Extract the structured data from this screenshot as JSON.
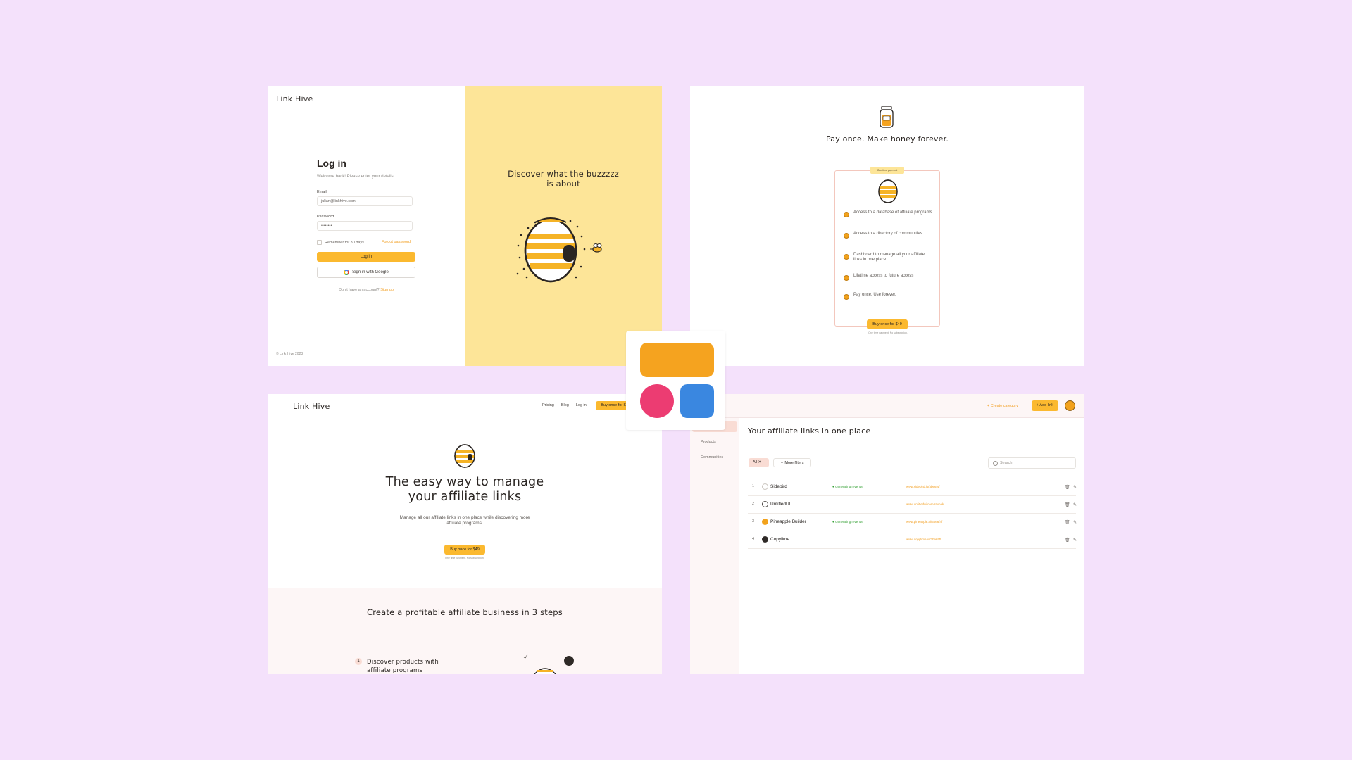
{
  "login": {
    "logo": "Link Hive",
    "title": "Log in",
    "subtitle": "Welcome back! Please enter your details.",
    "email_label": "Email",
    "email_value": "julian@linkhive.com",
    "password_label": "Password",
    "password_value": "••••••••",
    "remember": "Remember for 30 days",
    "forgot": "Forgot password",
    "login_button": "Log in",
    "google_button": "Sign in with Google",
    "no_account": "Don't have an account?",
    "signup": "Sign up",
    "copyright": "© Link Hive 2023",
    "tagline_1": "Discover what the buzzzzz",
    "tagline_2": "is about"
  },
  "pricing": {
    "headline": "Pay once. Make honey forever.",
    "badge": "One time payment",
    "features": [
      "Access to a database of affiliate programs",
      "Access to a directory of communities",
      "Dashboard to manage all your affiliate links in one place",
      "Lifetime access to future access",
      "Pay once. Use forever."
    ],
    "buy_button": "Buy once for $49",
    "note": "One time payment. No subscription."
  },
  "landing": {
    "logo": "Link Hive",
    "nav": [
      "Pricing",
      "Blog",
      "Log in"
    ],
    "nav_cta": "Buy once for $",
    "headline_1": "The easy way to manage",
    "headline_2": "your affiliate links",
    "description": "Manage all our affiliate links in one place while discovering more affiliate programs.",
    "buy_button": "Buy once for $49",
    "note": "One time payment. No subscription.",
    "steps_title": "Create a profitable affiliate business in 3 steps",
    "step_number": "1",
    "step_text": "Discover products with affiliate programs"
  },
  "dashboard": {
    "header_fragment": "e",
    "create_category": "+ Create category",
    "add_link": "+ Add link",
    "sidebar": [
      "Links",
      "Products",
      "Communities"
    ],
    "title": "Your affiliate links in one place",
    "filter_all": "All",
    "more_filters": "More filters",
    "search_placeholder": "Search",
    "rows": [
      {
        "idx": "1",
        "name": "Sidebird",
        "status": "Generating revenue",
        "url": "www.sidebird.io/3be6f4f",
        "icon_color": "#ffffff"
      },
      {
        "idx": "2",
        "name": "UntitledUI",
        "status": "",
        "url": "www.untitledui.com/ravoak",
        "icon_color": "#ffffff"
      },
      {
        "idx": "3",
        "name": "Pineapple Builder",
        "status": "Generating revenue",
        "url": "www.pineapple.ai/3be6f4f",
        "icon_color": "#f2a21c"
      },
      {
        "idx": "4",
        "name": "Copylime",
        "status": "",
        "url": "www.copylime.io/3be6f4f",
        "icon_color": "#2f2a27"
      }
    ]
  },
  "colors": {
    "background": "#f4e1fb",
    "yellow": "#fde598",
    "accent": "#fbb92f",
    "app_icon_orange": "#f5a31f",
    "app_icon_pink": "#ec3c72",
    "app_icon_blue": "#3a87e0"
  }
}
